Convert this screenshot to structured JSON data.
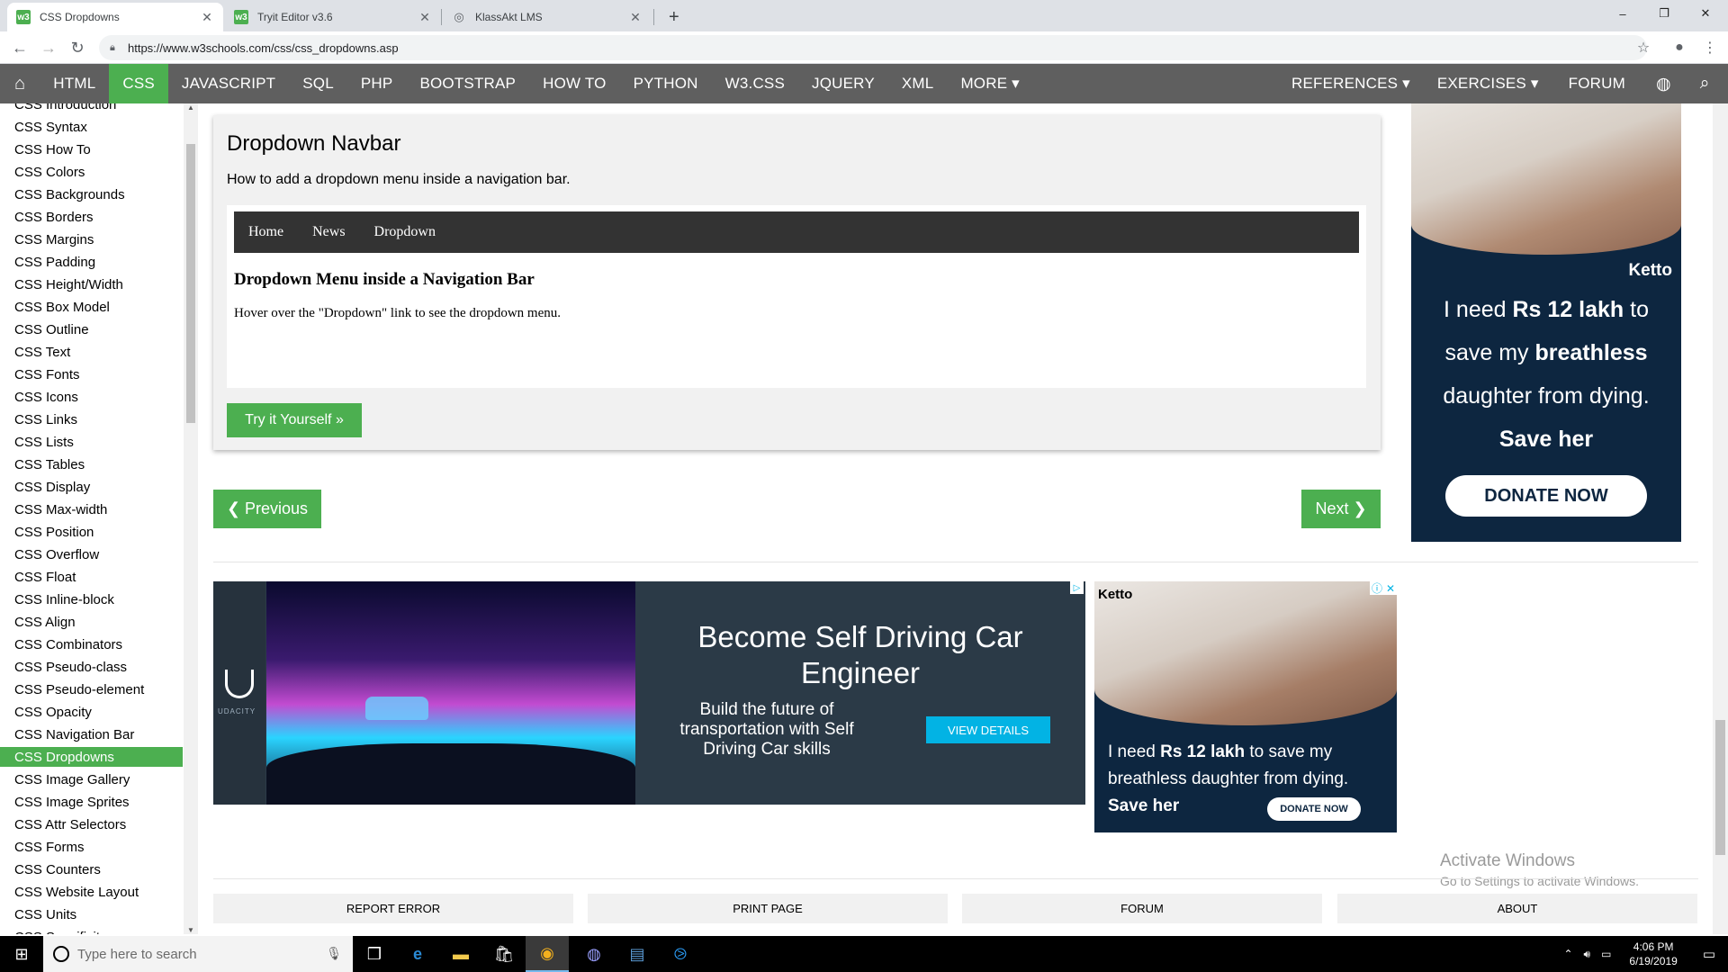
{
  "browser": {
    "tabs": [
      {
        "title": "CSS Dropdowns",
        "favicon": "w3-icon",
        "active": true
      },
      {
        "title": "Tryit Editor v3.6",
        "favicon": "w3-icon",
        "active": false
      },
      {
        "title": "KlassAkt LMS",
        "favicon": "globe-icon",
        "active": false
      }
    ],
    "new_tab": "+",
    "url": "https://www.w3schools.com/css/css_dropdowns.asp",
    "window_controls": {
      "minimize": "–",
      "restore": "❐",
      "close": "✕"
    }
  },
  "w3nav": {
    "items": [
      "HTML",
      "CSS",
      "JAVASCRIPT",
      "SQL",
      "PHP",
      "BOOTSTRAP",
      "HOW TO",
      "PYTHON",
      "W3.CSS",
      "JQUERY",
      "XML",
      "MORE ▾"
    ],
    "active": "CSS",
    "right_items": [
      "REFERENCES ▾",
      "EXERCISES ▾",
      "FORUM"
    ]
  },
  "sidebar": {
    "items": [
      "CSS Introduction",
      "CSS Syntax",
      "CSS How To",
      "CSS Colors",
      "CSS Backgrounds",
      "CSS Borders",
      "CSS Margins",
      "CSS Padding",
      "CSS Height/Width",
      "CSS Box Model",
      "CSS Outline",
      "CSS Text",
      "CSS Fonts",
      "CSS Icons",
      "CSS Links",
      "CSS Lists",
      "CSS Tables",
      "CSS Display",
      "CSS Max-width",
      "CSS Position",
      "CSS Overflow",
      "CSS Float",
      "CSS Inline-block",
      "CSS Align",
      "CSS Combinators",
      "CSS Pseudo-class",
      "CSS Pseudo-element",
      "CSS Opacity",
      "CSS Navigation Bar",
      "CSS Dropdowns",
      "CSS Image Gallery",
      "CSS Image Sprites",
      "CSS Attr Selectors",
      "CSS Forms",
      "CSS Counters",
      "CSS Website Layout",
      "CSS Units",
      "CSS Specificity"
    ],
    "active": "CSS Dropdowns"
  },
  "example": {
    "title": "Dropdown Navbar",
    "description": "How to add a dropdown menu inside a navigation bar.",
    "demo_nav": [
      "Home",
      "News",
      "Dropdown"
    ],
    "demo_heading": "Dropdown Menu inside a Navigation Bar",
    "demo_text": "Hover over the \"Dropdown\" link to see the dropdown menu.",
    "try_button": "Try it Yourself »"
  },
  "pager": {
    "previous": "❮ Previous",
    "next": "Next ❯"
  },
  "ad_right": {
    "logo": "Ketto",
    "lines": [
      "I need **Rs 12 lakh** to",
      "save my **breathless**",
      "daughter from dying.",
      "**Save her**"
    ],
    "line1_pre": "I need ",
    "line1_bold": "Rs 12 lakh",
    "line1_post": " to",
    "line2_pre": "save my ",
    "line2_bold": "breathless",
    "line3": "daughter from dying.",
    "line4": "Save her",
    "donate": "DONATE NOW"
  },
  "ad_udacity": {
    "logo_text": "UDACITY",
    "headline": "Become Self Driving Car Engineer",
    "subtext": "Build the future of transportation with Self Driving Car skills",
    "button": "VIEW DETAILS"
  },
  "ad_ketto2": {
    "logo": "Ketto",
    "text_pre": "I need ",
    "text_bold": "Rs 12 lakh",
    "text_post": " to save my breathless daughter from dying.",
    "save": "Save her",
    "donate": "DONATE NOW"
  },
  "watermark": {
    "line1": "Activate Windows",
    "line2": "Go to Settings to activate Windows."
  },
  "footer": [
    "REPORT ERROR",
    "PRINT PAGE",
    "FORUM",
    "ABOUT"
  ],
  "taskbar": {
    "search_placeholder": "Type here to search",
    "time": "4:06 PM",
    "date": "6/19/2019"
  },
  "colors": {
    "w3_green": "#4caf50",
    "w3_nav_gray": "#5f5f5f",
    "ketto_navy": "#0d2640",
    "udacity_blue": "#02b3e4"
  }
}
